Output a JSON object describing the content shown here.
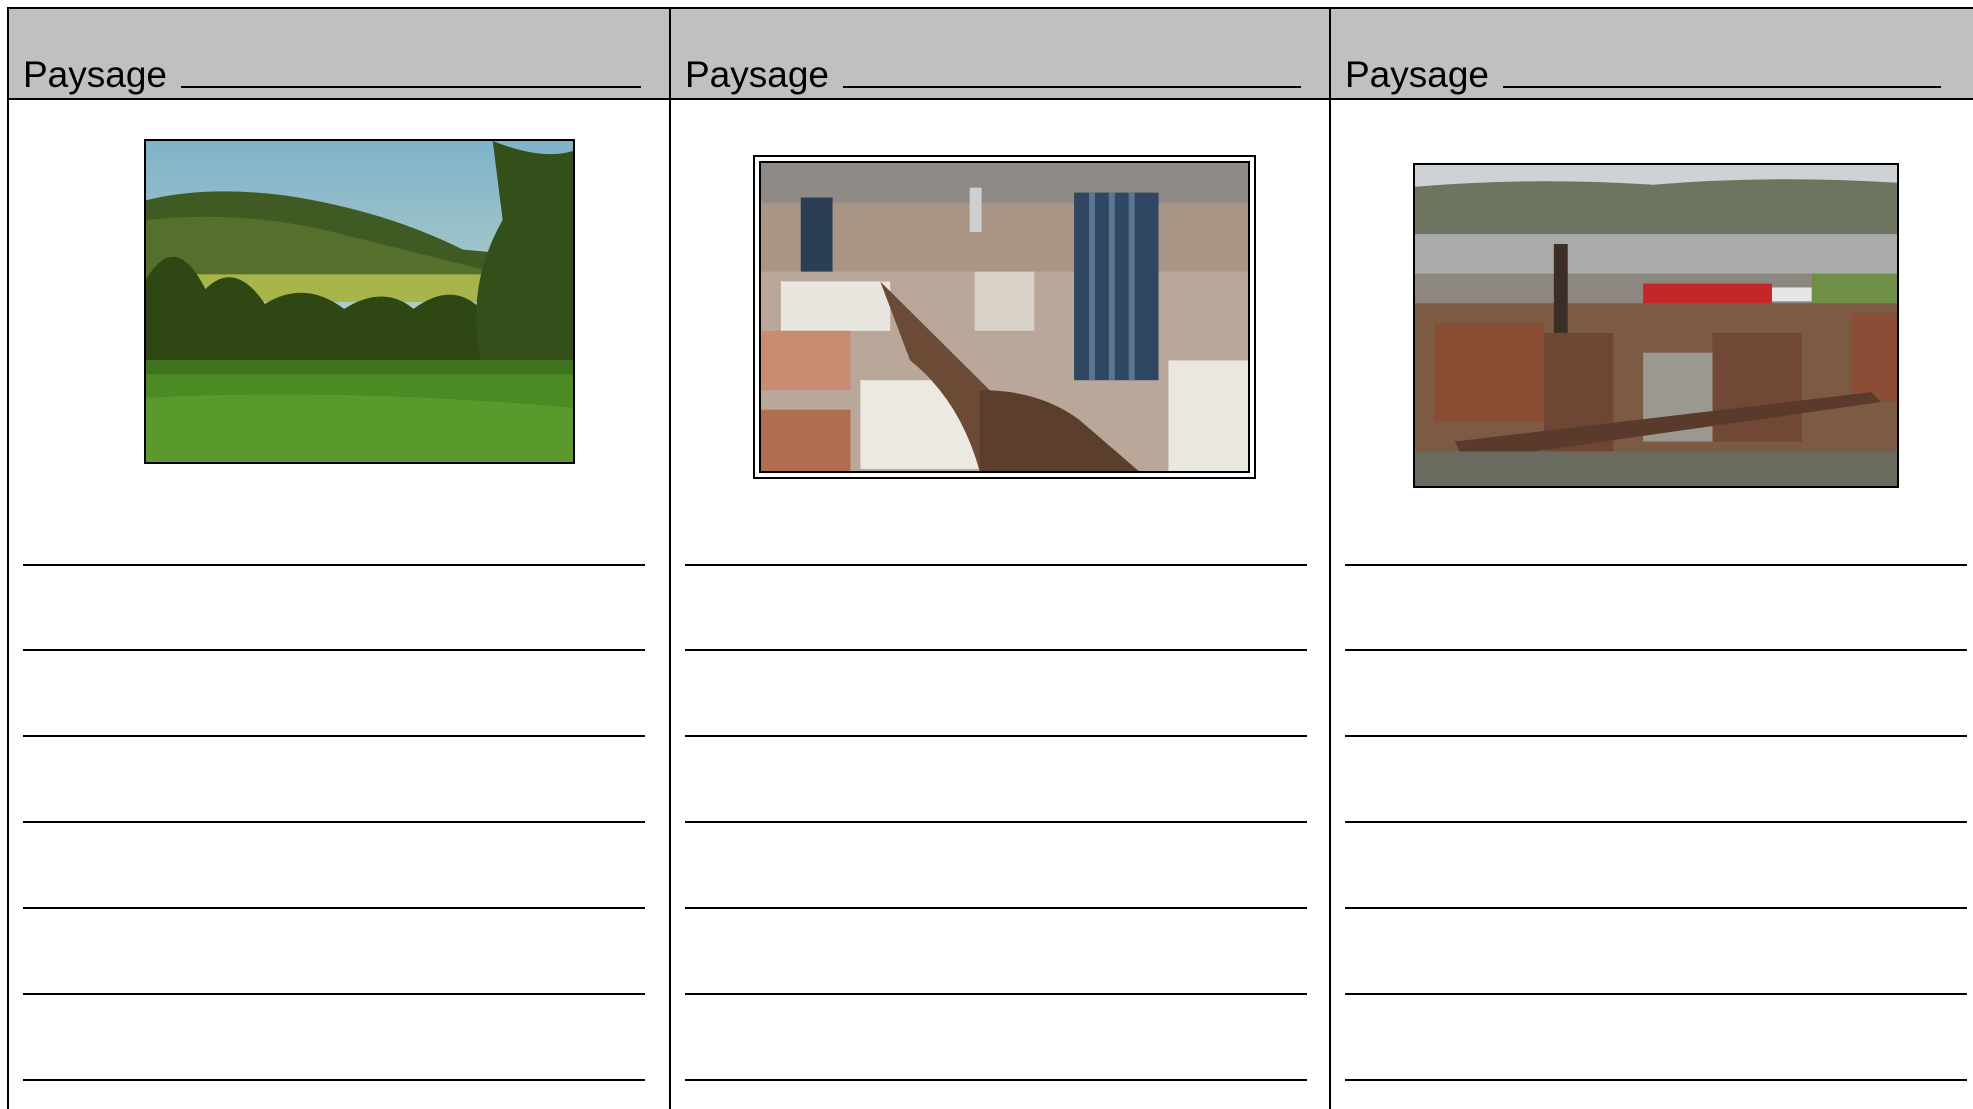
{
  "worksheet": {
    "columns": [
      {
        "heading": "Paysage",
        "image": "rural-countryside-landscape-photo"
      },
      {
        "heading": "Paysage",
        "image": "urban-city-landscape-photo"
      },
      {
        "heading": "Paysage",
        "image": "industrial-steelworks-landscape-photo"
      }
    ],
    "answer_lines_per_column": 7
  }
}
